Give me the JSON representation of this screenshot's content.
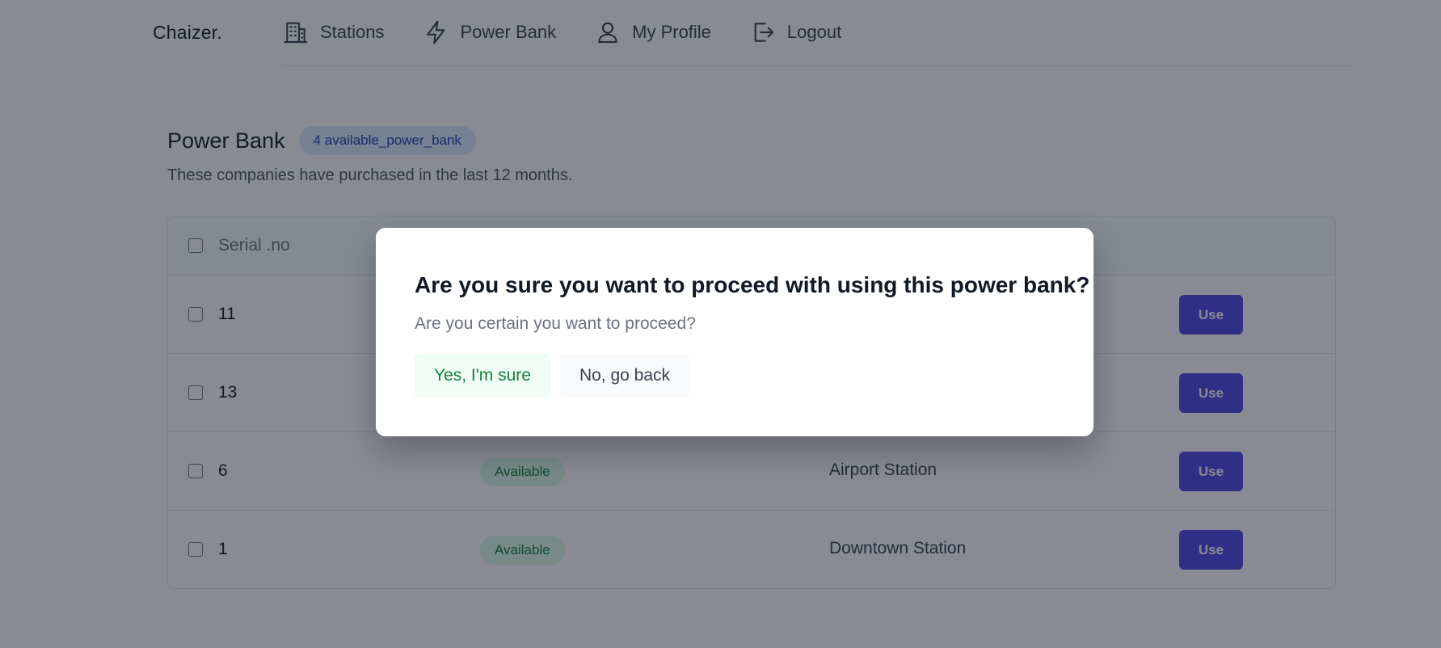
{
  "app": {
    "logo": "Chaizer."
  },
  "nav": {
    "items": [
      {
        "label": "Stations",
        "icon": "building-icon"
      },
      {
        "label": "Power Bank",
        "icon": "lightning-icon"
      },
      {
        "label": "My Profile",
        "icon": "user-icon"
      },
      {
        "label": "Logout",
        "icon": "logout-icon"
      }
    ]
  },
  "page": {
    "title": "Power Bank",
    "badge": "4 available_power_bank",
    "subtitle": "These companies have purchased in the last 12 months."
  },
  "table": {
    "header": {
      "serial": "Serial .no"
    },
    "rows": [
      {
        "serial": "11",
        "status": "",
        "station": "",
        "action": "Use"
      },
      {
        "serial": "13",
        "status": "",
        "station": "",
        "action": "Use"
      },
      {
        "serial": "6",
        "status": "Available",
        "station": "Airport Station",
        "action": "Use"
      },
      {
        "serial": "1",
        "status": "Available",
        "station": "Downtown Station",
        "action": "Use"
      }
    ]
  },
  "modal": {
    "title": "Are you sure you want to proceed with using this power bank?",
    "text": "Are you certain you want to proceed?",
    "confirm_label": "Yes, I'm sure",
    "cancel_label": "No, go back"
  },
  "colors": {
    "accent": "#4f46e5",
    "available_bg": "#dcfce7",
    "available_text": "#15803d",
    "badge_bg": "#dbeafe",
    "badge_text": "#1e40af",
    "overlay": "rgba(17,24,39,0.5)"
  }
}
